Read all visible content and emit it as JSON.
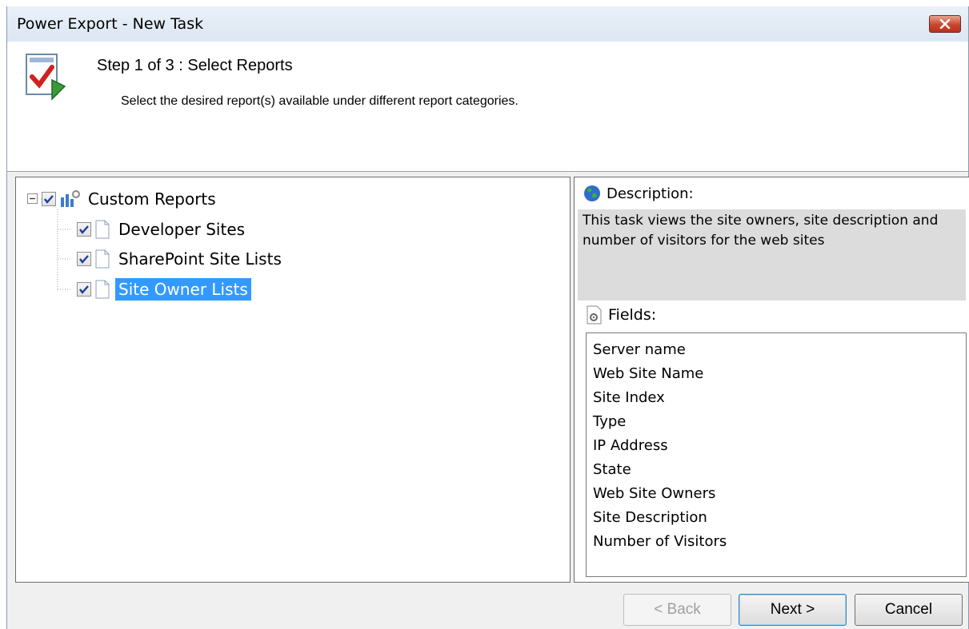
{
  "window": {
    "title": "Power Export - New Task"
  },
  "header": {
    "step_title": "Step 1 of 3 : Select Reports",
    "step_subtitle": "Select the desired report(s) available under different report categories."
  },
  "tree": {
    "root": {
      "label": "Custom Reports",
      "checked": true,
      "expanded": true
    },
    "children": [
      {
        "label": "Developer Sites",
        "checked": true
      },
      {
        "label": "SharePoint Site Lists",
        "checked": true
      },
      {
        "label": "Site Owner Lists",
        "checked": true,
        "selected": true
      }
    ]
  },
  "description": {
    "heading": "Description:",
    "text": "This task views the site owners, site description and number of visitors for the web sites"
  },
  "fields": {
    "heading": "Fields:",
    "items": [
      "Server name",
      "Web Site Name",
      "Site Index",
      "Type",
      "IP Address",
      "State",
      "Web Site Owners",
      "Site Description",
      "Number of Visitors"
    ]
  },
  "buttons": {
    "back": "< Back",
    "next": "Next >",
    "cancel": "Cancel"
  },
  "colors": {
    "selection": "#3399ff",
    "close_button": "#c9452d"
  }
}
